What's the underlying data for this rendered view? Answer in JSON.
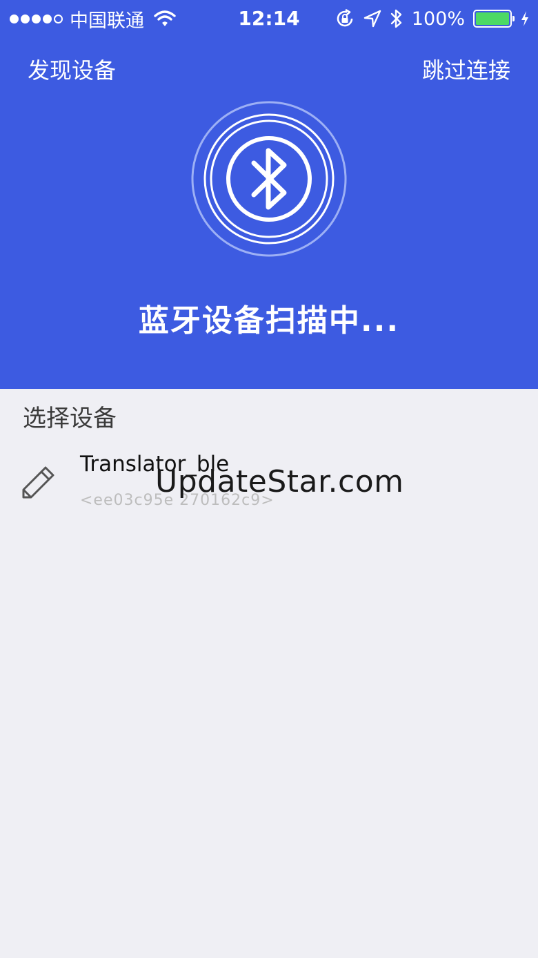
{
  "status_bar": {
    "carrier": "中国联通",
    "time": "12:14",
    "battery": "100%",
    "signal_bars": 4,
    "icons": [
      "wifi-icon",
      "orientation-lock-icon",
      "location-icon",
      "bluetooth-icon",
      "battery-icon",
      "charging-icon"
    ]
  },
  "nav": {
    "title": "发现设备",
    "skip": "跳过连接"
  },
  "scan": {
    "icon": "bluetooth-icon",
    "status": "蓝牙设备扫描中..."
  },
  "device_list": {
    "section_label": "选择设备",
    "devices": [
      {
        "icon": "pencil-icon",
        "name": "Translator_ble",
        "id": "<ee03c95e 270162c9>"
      }
    ]
  },
  "watermark": "UpdateStar.com",
  "colors": {
    "header_bg": "#3d5be1",
    "body_bg": "#efeff4",
    "battery_fill": "#4cd964"
  }
}
